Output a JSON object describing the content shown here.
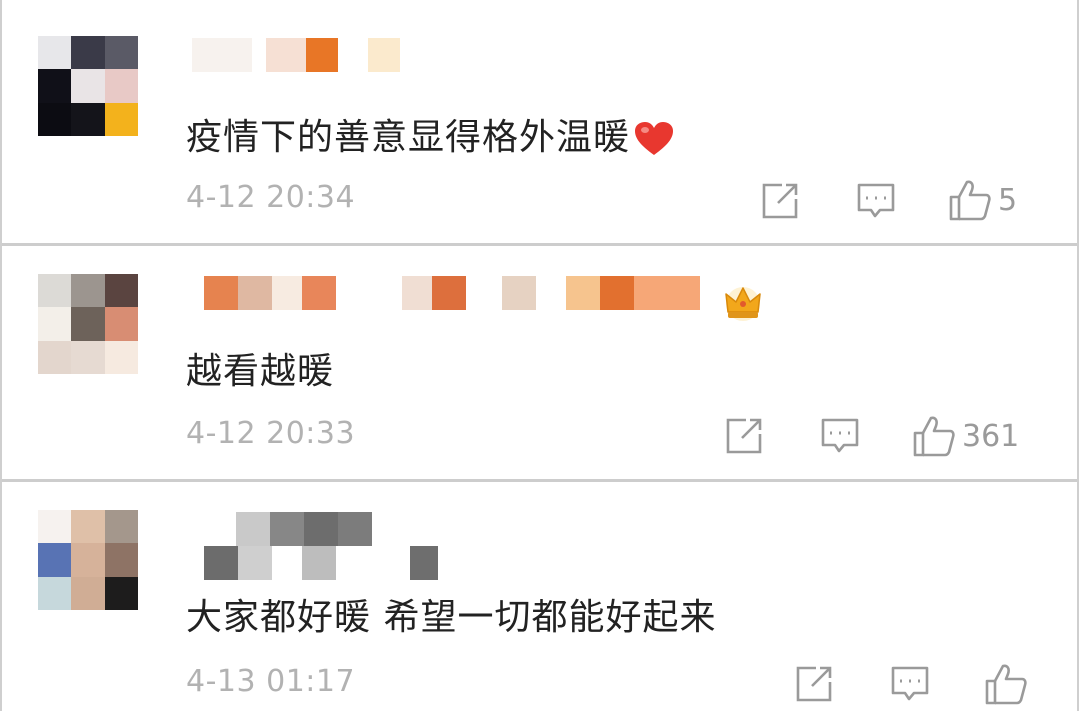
{
  "comments": [
    {
      "text": "疫情下的善意显得格外温暖",
      "has_heart": true,
      "time": "4-12 20:34",
      "likes": "5"
    },
    {
      "text": "越看越暖",
      "has_heart": false,
      "has_crown_badge": true,
      "time": "4-12 20:33",
      "likes": "361"
    },
    {
      "text": "大家都好暖 希望一切都能好起来",
      "has_heart": false,
      "time": "4-13 01:17",
      "likes": ""
    }
  ],
  "icons": {
    "share": "share-icon",
    "reply": "comment-icon",
    "like": "thumbs-up-icon",
    "heart": "heart-icon",
    "crown": "crown-icon"
  },
  "colors": {
    "text": "#222222",
    "meta": "#b2b2b2",
    "icon": "#9a9a9a",
    "heart": "#e8372f",
    "crown": "#f2a71b",
    "divider": "#cdcdcd"
  }
}
